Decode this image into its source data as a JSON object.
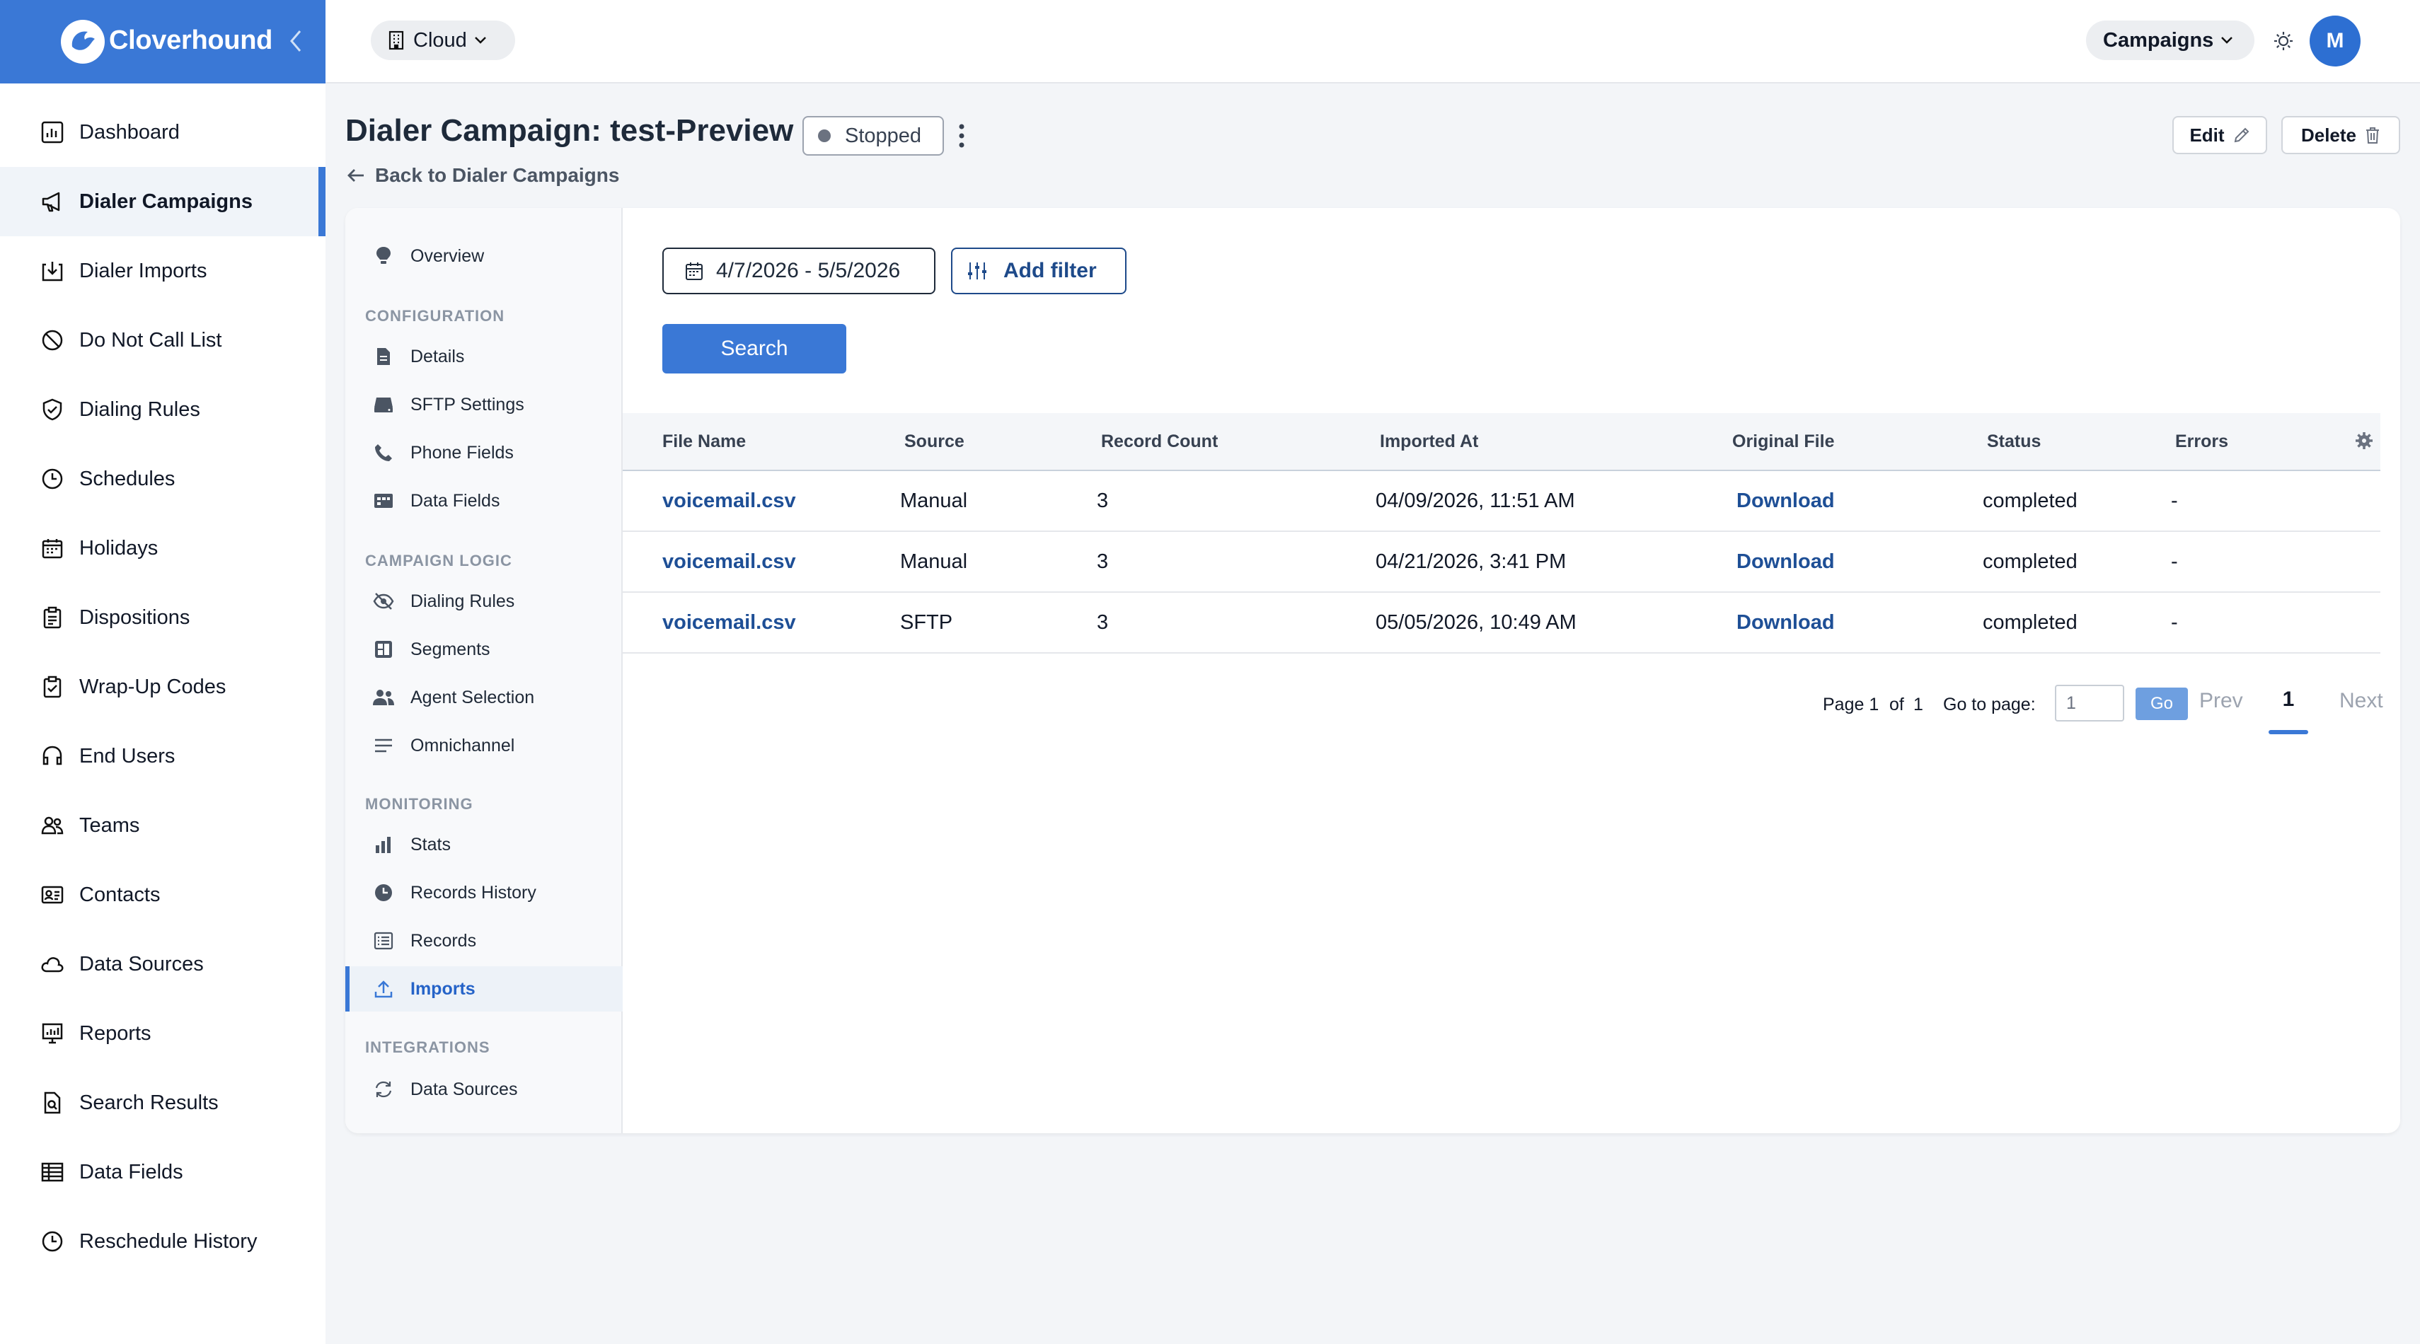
{
  "brand": {
    "name": "Cloverhound"
  },
  "sidebar": {
    "items": [
      {
        "label": "Dashboard",
        "icon": "dashboard-icon"
      },
      {
        "label": "Dialer Campaigns",
        "icon": "megaphone-icon",
        "active": true
      },
      {
        "label": "Dialer Imports",
        "icon": "import-icon"
      },
      {
        "label": "Do Not Call List",
        "icon": "ban-icon"
      },
      {
        "label": "Dialing Rules",
        "icon": "shield-icon"
      },
      {
        "label": "Schedules",
        "icon": "clock-icon"
      },
      {
        "label": "Holidays",
        "icon": "calendar-icon"
      },
      {
        "label": "Dispositions",
        "icon": "clipboard-icon"
      },
      {
        "label": "Wrap-Up Codes",
        "icon": "clipboard-check-icon"
      },
      {
        "label": "End Users",
        "icon": "headset-icon"
      },
      {
        "label": "Teams",
        "icon": "users-icon"
      },
      {
        "label": "Contacts",
        "icon": "contact-card-icon"
      },
      {
        "label": "Data Sources",
        "icon": "cloud-icon"
      },
      {
        "label": "Reports",
        "icon": "presentation-icon"
      },
      {
        "label": "Search Results",
        "icon": "file-search-icon"
      },
      {
        "label": "Data Fields",
        "icon": "table-icon"
      },
      {
        "label": "Reschedule History",
        "icon": "clock-icon"
      }
    ]
  },
  "topbar": {
    "org_label": "Cloud",
    "campaigns_label": "Campaigns",
    "avatar_initial": "M"
  },
  "header": {
    "title": "Dialer Campaign: test-Preview",
    "status": "Stopped",
    "back_label": "Back to Dialer Campaigns",
    "edit_label": "Edit",
    "delete_label": "Delete"
  },
  "subnav": {
    "overview": "Overview",
    "configuration": {
      "heading": "CONFIGURATION",
      "items": [
        "Details",
        "SFTP Settings",
        "Phone Fields",
        "Data Fields"
      ]
    },
    "campaign_logic": {
      "heading": "CAMPAIGN LOGIC",
      "items": [
        "Dialing Rules",
        "Segments",
        "Agent Selection",
        "Omnichannel"
      ]
    },
    "monitoring": {
      "heading": "MONITORING",
      "items": [
        "Stats",
        "Records History",
        "Records",
        "Imports"
      ]
    },
    "integrations": {
      "heading": "INTEGRATIONS",
      "items": [
        "Data Sources"
      ]
    }
  },
  "filters": {
    "date_range": "4/7/2026 - 5/5/2026",
    "add_filter_label": "Add filter",
    "search_label": "Search"
  },
  "table": {
    "headers": [
      "File Name",
      "Source",
      "Record Count",
      "Imported At",
      "Original File",
      "Status",
      "Errors"
    ],
    "rows": [
      {
        "file": "voicemail.csv",
        "source": "Manual",
        "count": "3",
        "imported": "04/09/2026, 11:51 AM",
        "original": "Download",
        "status": "completed",
        "errors": "-"
      },
      {
        "file": "voicemail.csv",
        "source": "Manual",
        "count": "3",
        "imported": "04/21/2026, 3:41 PM",
        "original": "Download",
        "status": "completed",
        "errors": "-"
      },
      {
        "file": "voicemail.csv",
        "source": "SFTP",
        "count": "3",
        "imported": "05/05/2026, 10:49 AM",
        "original": "Download",
        "status": "completed",
        "errors": "-"
      }
    ]
  },
  "pager": {
    "page_label": "Page 1",
    "of_label": "of",
    "total_pages": "1",
    "goto_label": "Go to page:",
    "goto_value": "1",
    "go_label": "Go",
    "prev_label": "Prev",
    "current": "1",
    "next_label": "Next"
  }
}
